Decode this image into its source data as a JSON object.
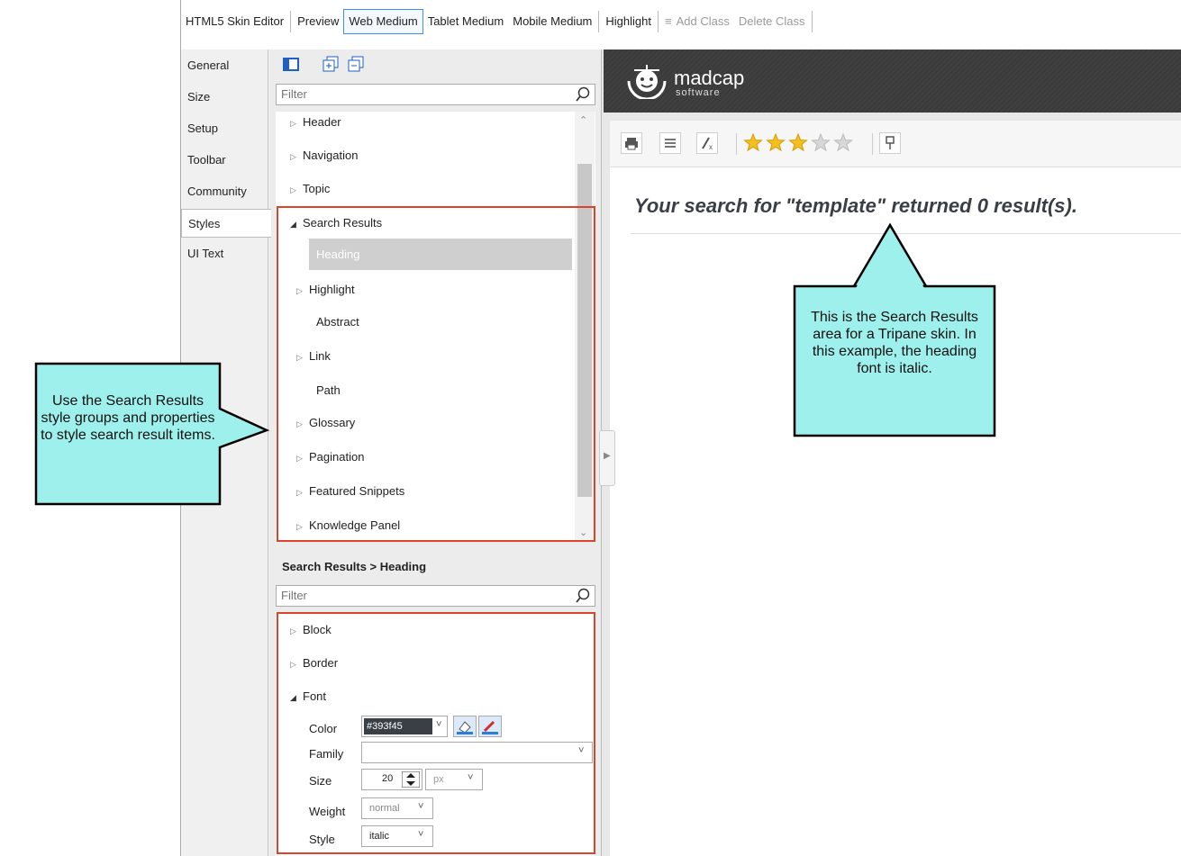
{
  "toolbar": {
    "items": [
      "HTML5 Skin Editor",
      "Preview",
      "Web Medium",
      "Tablet Medium",
      "Mobile Medium",
      "Highlight",
      "Add Class",
      "Delete Class"
    ]
  },
  "tabs": [
    "General",
    "Size",
    "Setup",
    "Toolbar",
    "Community",
    "Styles",
    "UI Text"
  ],
  "tree": {
    "filter_placeholder": "Filter",
    "items": [
      "Header",
      "Navigation",
      "Topic",
      "Search Results",
      "Heading",
      "Highlight",
      "Abstract",
      "Link",
      "Path",
      "Glossary",
      "Pagination",
      "Featured Snippets",
      "Knowledge Panel"
    ]
  },
  "properties": {
    "breadcrumb": "Search Results > Heading",
    "filter_placeholder": "Filter",
    "groups": [
      "Block",
      "Border",
      "Font"
    ],
    "labels": [
      "Color",
      "Family",
      "Size",
      "Weight",
      "Style"
    ],
    "color_value": "#393f45",
    "family_value": "",
    "size_value": "20",
    "size_unit": "px",
    "weight_value": "normal",
    "style_value": "italic"
  },
  "preview": {
    "logo_text": "madcap",
    "logo_sub": "software",
    "rating": 3,
    "rating_max": 5,
    "heading": "Your search for \"template\" returned 0 result(s)."
  },
  "callouts": {
    "left": "Use the Search Results style groups and properties to style search result items.",
    "right": "This is the Search Results area for a Tripane skin. In this example, the heading font is italic."
  },
  "colors": {
    "accent_border": "#d9442a",
    "callout_fill": "#9ef0ec",
    "heading_color": "#393f45"
  }
}
